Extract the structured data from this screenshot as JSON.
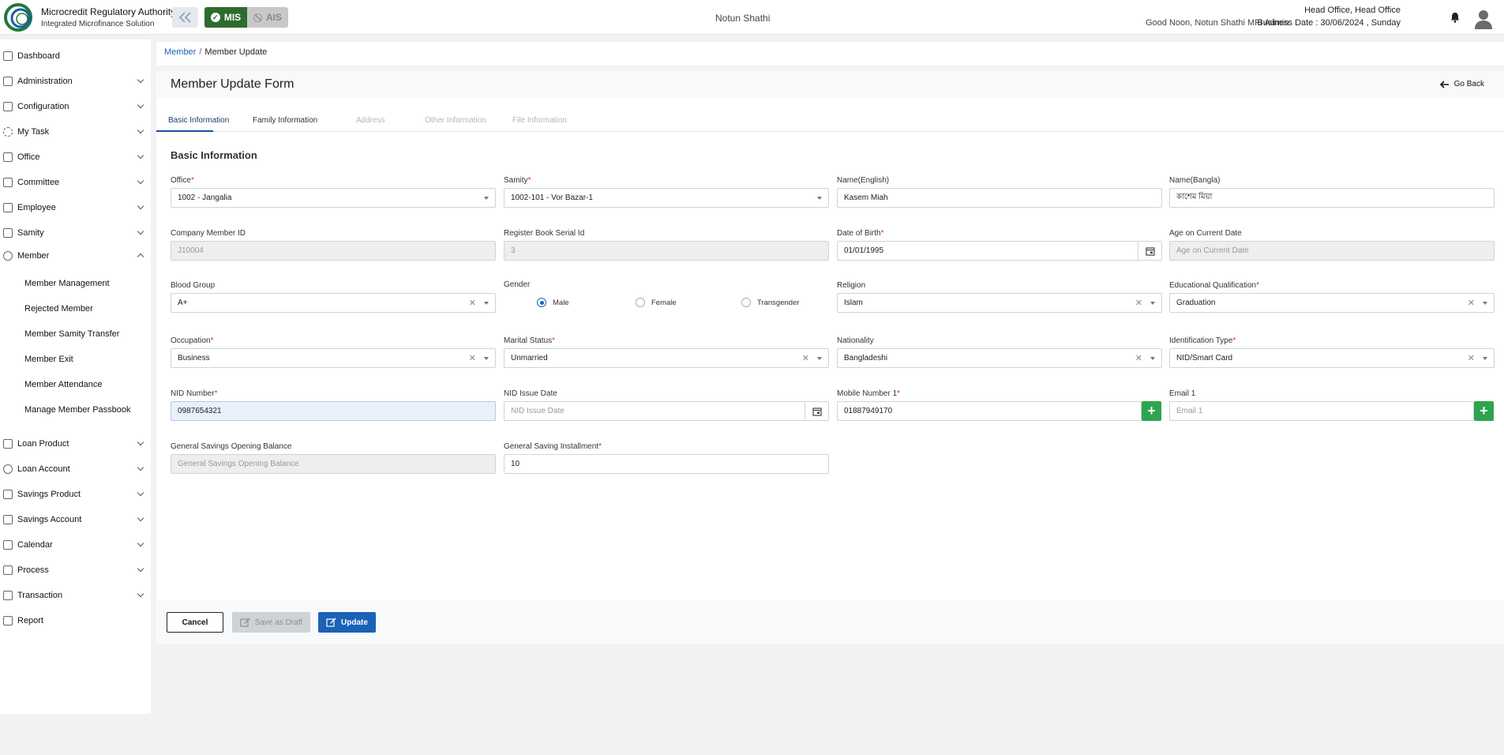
{
  "header": {
    "brand_title": "Microcredit Regulatory Authority",
    "brand_subtitle": "Integrated Microfinance Solution",
    "mode_mis": "MIS",
    "mode_ais": "AIS",
    "org_name": "Notun Shathi",
    "greeting": "Good Noon, Notun Shathi MFI Admin",
    "office": "Head Office, Head Office",
    "business_date": "Business Date : 30/06/2024 , Sunday"
  },
  "sidebar": {
    "items": [
      {
        "label": "Dashboard"
      },
      {
        "label": "Administration"
      },
      {
        "label": "Configuration"
      },
      {
        "label": "My Task"
      },
      {
        "label": "Office"
      },
      {
        "label": "Committee"
      },
      {
        "label": "Employee"
      },
      {
        "label": "Samity"
      },
      {
        "label": "Member"
      },
      {
        "label": "Loan Product"
      },
      {
        "label": "Loan Account"
      },
      {
        "label": "Savings Product"
      },
      {
        "label": "Savings Account"
      },
      {
        "label": "Calendar"
      },
      {
        "label": "Process"
      },
      {
        "label": "Transaction"
      },
      {
        "label": "Report"
      }
    ],
    "member_sub": [
      {
        "label": "Member Management"
      },
      {
        "label": "Rejected Member"
      },
      {
        "label": "Member Samity Transfer"
      },
      {
        "label": "Member Exit"
      },
      {
        "label": "Member Attendance"
      },
      {
        "label": "Manage Member Passbook"
      }
    ]
  },
  "breadcrumb": {
    "parent": "Member",
    "current": "Member Update"
  },
  "form": {
    "title": "Member Update Form",
    "go_back": "Go Back",
    "tabs": [
      {
        "label": "Basic Information"
      },
      {
        "label": "Family Information"
      },
      {
        "label": "Address"
      },
      {
        "label": "Other Information"
      },
      {
        "label": "File Information"
      }
    ],
    "section_title": "Basic Information",
    "fields": {
      "office": {
        "label": "Office",
        "value": "1002 - Jangalia"
      },
      "samity": {
        "label": "Samity",
        "value": "1002-101 - Vor Bazar-1"
      },
      "name_en": {
        "label": "Name(English)",
        "value": "Kasem Miah"
      },
      "name_bn": {
        "label": "Name(Bangla)",
        "value": "কাশেম মিয়া"
      },
      "company_member_id": {
        "label": "Company Member ID",
        "value": "J10004"
      },
      "register_book_serial": {
        "label": "Register Book Serial Id",
        "value": "3"
      },
      "dob": {
        "label": "Date of Birth",
        "value": "01/01/1995"
      },
      "age": {
        "label": "Age on Current Date",
        "placeholder": "Age on Current Date"
      },
      "blood_group": {
        "label": "Blood Group",
        "value": "A+"
      },
      "gender": {
        "label": "Gender",
        "options": [
          "Male",
          "Female",
          "Transgender"
        ],
        "selected": "Male"
      },
      "religion": {
        "label": "Religion",
        "value": "Islam"
      },
      "education": {
        "label": "Educational Qualification",
        "value": "Graduation"
      },
      "occupation": {
        "label": "Occupation",
        "value": "Business"
      },
      "marital": {
        "label": "Marital Status",
        "value": "Unmarried"
      },
      "nationality": {
        "label": "Nationality",
        "value": "Bangladeshi"
      },
      "id_type": {
        "label": "Identification Type",
        "value": "NID/Smart Card"
      },
      "nid": {
        "label": "NID Number",
        "value": "0987654321"
      },
      "nid_issue": {
        "label": "NID Issue Date",
        "placeholder": "NID Issue Date"
      },
      "mobile": {
        "label": "Mobile Number 1",
        "value": "01887949170"
      },
      "email": {
        "label": "Email 1",
        "placeholder": "Email 1"
      },
      "gs_opening": {
        "label": "General Savings Opening Balance",
        "placeholder": "General Savings Opening Balance"
      },
      "gs_installment": {
        "label": "General Saving Installment",
        "value": "10"
      }
    },
    "buttons": {
      "cancel": "Cancel",
      "draft": "Save as Draft",
      "update": "Update"
    }
  },
  "colors": {
    "primary": "#1a62b7",
    "mis_green": "#2d6b2e",
    "add_green": "#2ea44f",
    "required": "#d32f2f"
  }
}
